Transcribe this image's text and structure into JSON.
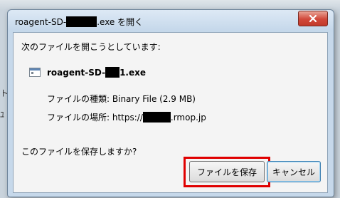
{
  "window": {
    "title_prefix": "roagent-SD-",
    "title_suffix": ".exe を開く",
    "close_icon": "close-x-icon"
  },
  "dialog": {
    "intro": "次のファイルを開こうとしています:",
    "file": {
      "icon": "application-file-icon",
      "name_prefix": "roagent-SD-",
      "name_suffix": "1.exe"
    },
    "type_label": "ファイルの種類:",
    "type_value": "Binary File (2.9 MB)",
    "location_label": "ファイルの場所:",
    "location_prefix": "https://",
    "location_suffix": ".rmop.jp",
    "question": "このファイルを保存しますか?"
  },
  "buttons": {
    "save": "ファイルを保存",
    "cancel": "キャンセル"
  },
  "colors": {
    "highlight": "#e00000",
    "close_button": "#d1483a",
    "frame": "#c6d8ea"
  }
}
